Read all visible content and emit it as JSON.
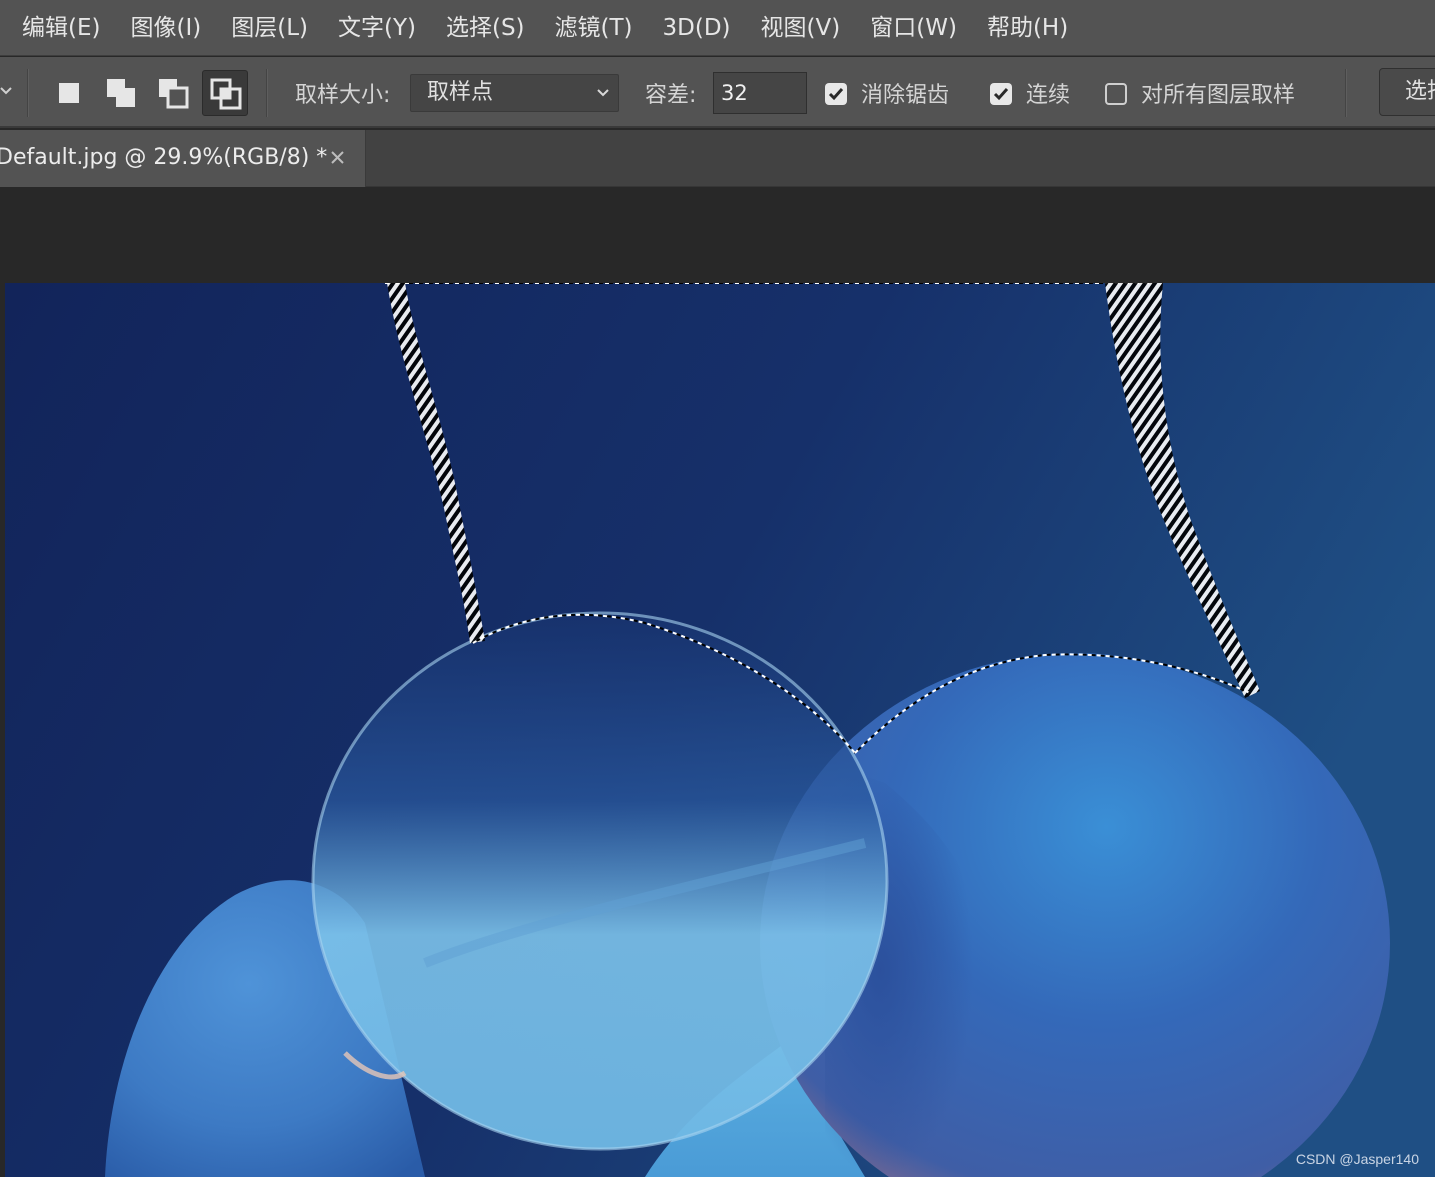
{
  "menu": {
    "items": [
      "编辑(E)",
      "图像(I)",
      "图层(L)",
      "文字(Y)",
      "选择(S)",
      "滤镜(T)",
      "3D(D)",
      "视图(V)",
      "窗口(W)",
      "帮助(H)"
    ]
  },
  "options": {
    "selection_modes": [
      "new-selection",
      "add-to-selection",
      "subtract-from-selection",
      "intersect-with-selection"
    ],
    "active_mode": "intersect-with-selection",
    "sample_size_label": "取样大小:",
    "sample_size_value": "取样点",
    "tolerance_label": "容差:",
    "tolerance_value": "32",
    "anti_alias_label": "消除锯齿",
    "anti_alias_checked": true,
    "contiguous_label": "连续",
    "contiguous_checked": true,
    "sample_all_layers_label": "对所有图层取样",
    "sample_all_layers_checked": false,
    "select_subject_label": "选择主体"
  },
  "document": {
    "tab_title": "Default.jpg @ 29.9%(RGB/8) *"
  },
  "canvas": {
    "watermark": "CSDN @Jasper140",
    "colors": {
      "background_dark": "#12265a",
      "background_light": "#1e4b80",
      "sphere_blue": "#3a78c8",
      "glass_highlight": "#8fd0f2"
    }
  }
}
